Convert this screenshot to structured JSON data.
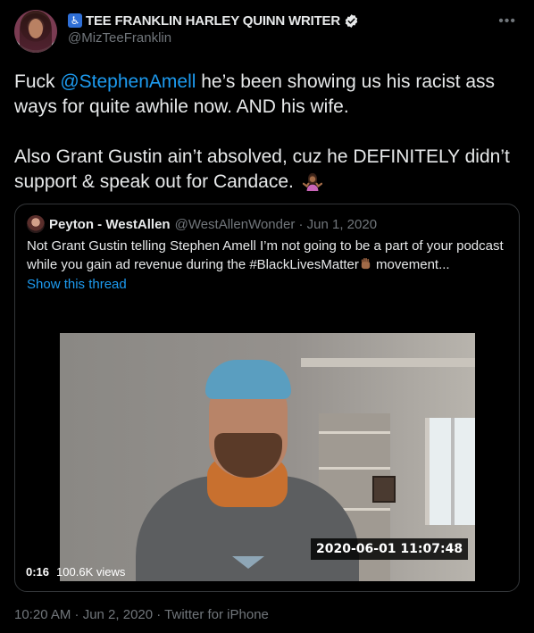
{
  "author": {
    "display_name": "TEE FRANKLIN HARLEY QUINN WRITER",
    "name_prefix_icon": "wheelchair-icon",
    "verified": true,
    "handle": "@MizTeeFranklin"
  },
  "tweet": {
    "text_part1": "Fuck ",
    "mention": "@StephenAmell",
    "text_part2": " he’s been showing us his racist ass ways for quite awhile now. AND his wife.",
    "text_para2": "Also Grant Gustin ain’t absolved, cuz he DEFINITELY didn’t support & speak out for Candace.",
    "emoji": "woman-shrugging-icon"
  },
  "quote": {
    "name": "Peyton - WestAllen",
    "handle_date": "@WestAllenWonder · Jun 1, 2020",
    "text_part1": "Not Grant Gustin telling Stephen Amell I’m not going to be a part of your podcast while you gain ad revenue during the #BlackLivesMatter",
    "text_part2": " movement...",
    "show_thread": "Show this thread",
    "video": {
      "overlay_timestamp": "2020-06-01  11:07:48",
      "duration": "0:16",
      "views": "100.6K views"
    }
  },
  "footer": {
    "meta": "10:20 AM · Jun 2, 2020 · Twitter for iPhone"
  },
  "colors": {
    "background": "#000000",
    "text": "#e7e9ea",
    "muted": "#71767b",
    "link": "#1d9bf0",
    "border": "#333639"
  }
}
